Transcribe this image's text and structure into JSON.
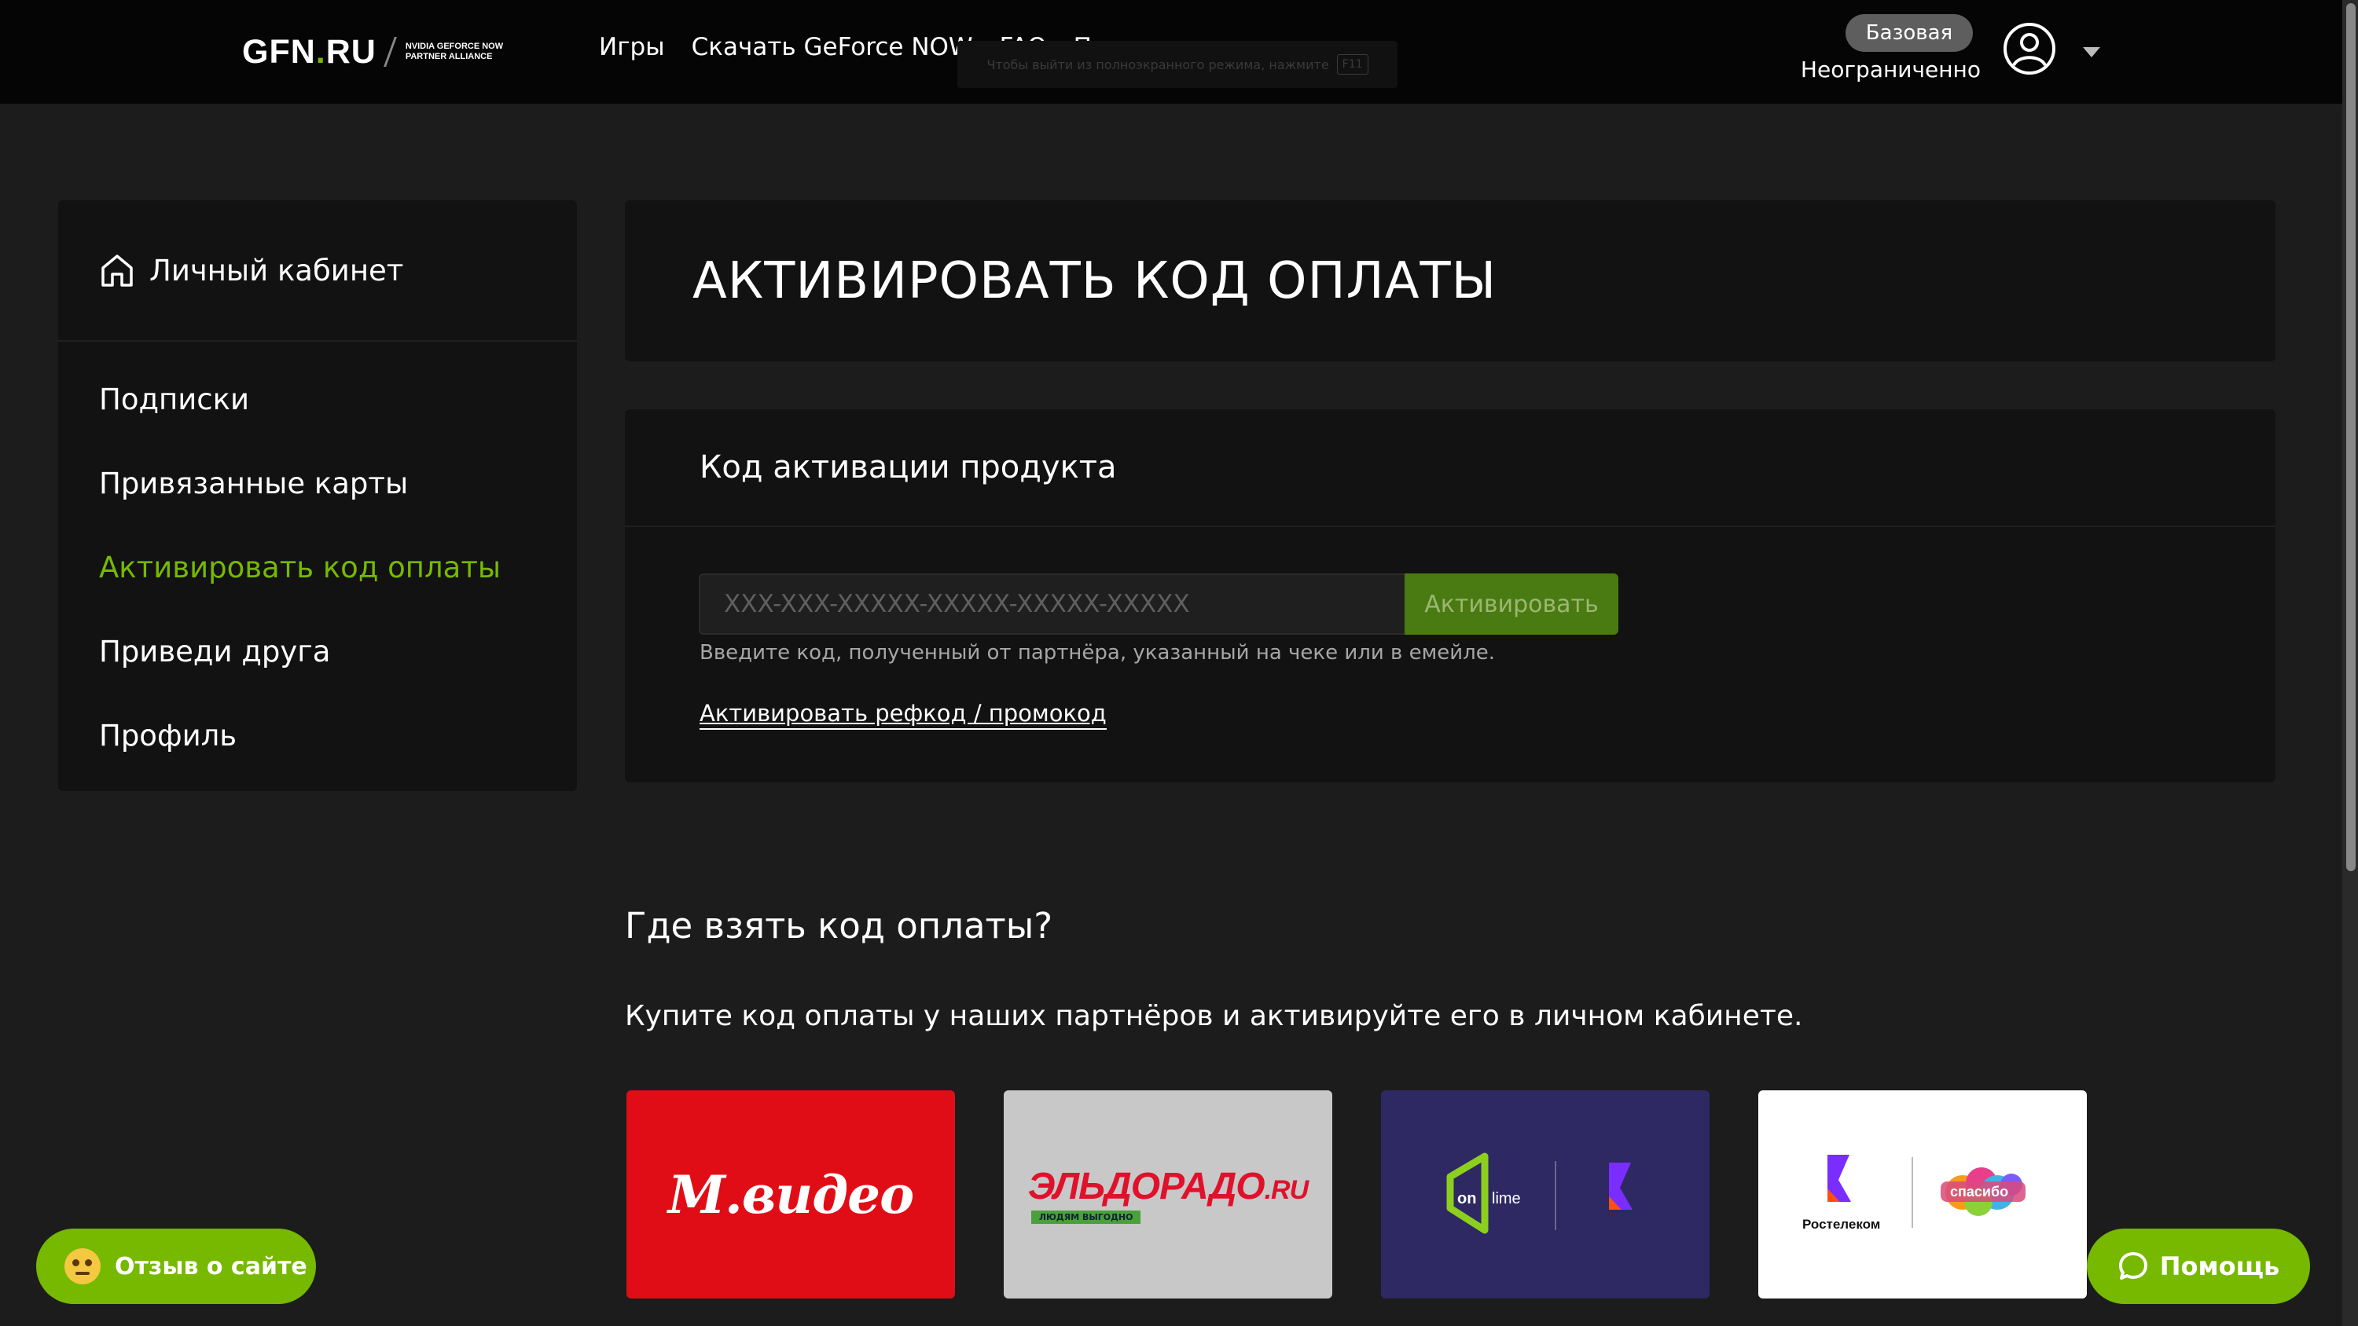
{
  "header": {
    "logo_main": "GFN",
    "logo_dot": ".",
    "logo_tld": "RU",
    "logo_sub_line1": "NVIDIA GEFORCE NOW",
    "logo_sub_line2": "PARTNER ALLIANCE",
    "nav": [
      {
        "label": "Игры"
      },
      {
        "label": "Скачать GeForce NOW"
      },
      {
        "label": "FAQ"
      },
      {
        "label": "Поддержка"
      }
    ],
    "fullscreen_hint": "Чтобы выйти из полноэкранного режима, нажмите",
    "fullscreen_key": "F11",
    "plan_badge": "Базовая",
    "plan_label": "Неограниченно",
    "avatar_icon": "user-circle-icon",
    "dropdown_icon": "caret-down-icon"
  },
  "sidebar": {
    "home_icon": "home-icon",
    "title": "Личный кабинет",
    "items": [
      {
        "label": "Подписки",
        "active": false
      },
      {
        "label": "Привязанные карты",
        "active": false
      },
      {
        "label": "Активировать код оплаты",
        "active": true
      },
      {
        "label": "Приведи друга",
        "active": false
      },
      {
        "label": "Профиль",
        "active": false
      }
    ]
  },
  "main": {
    "title": "АКТИВИРОВАТЬ КОД ОПЛАТЫ",
    "code_card": {
      "heading": "Код активации продукта",
      "input_value": "",
      "input_placeholder": "XXX-XXX-XXXXX-XXXXX-XXXXX-XXXXX",
      "activate_label": "Активировать",
      "hint": "Введите код, полученный от партнёра, указанный на чеке или в емейле.",
      "promo_link": "Активировать рефкод / промокод"
    },
    "where": {
      "title": "Где взять код оплаты?",
      "description": "Купите код оплаты у наших партнёров и активируйте его в личном кабинете."
    },
    "partners": [
      {
        "name": "М.видео",
        "bg": "#e10d16"
      },
      {
        "name": "ЭЛЬДОРАДО",
        "suffix": ".RU",
        "tagline": "ЛЮДЯМ ВЫГОДНО",
        "bg": "#c8c8c8"
      },
      {
        "name": "onlime",
        "prefix": "on",
        "word": "lime",
        "bg": "#2e2863"
      },
      {
        "name": "Ростелеком",
        "extra": "спасибо",
        "bg": "#ffffff"
      }
    ]
  },
  "floating": {
    "feedback_label": "Отзыв о сайте",
    "help_label": "Помощь"
  },
  "colors": {
    "accent": "#76b900",
    "background": "#1c1c1c",
    "card": "#121212",
    "header": "#050505"
  }
}
